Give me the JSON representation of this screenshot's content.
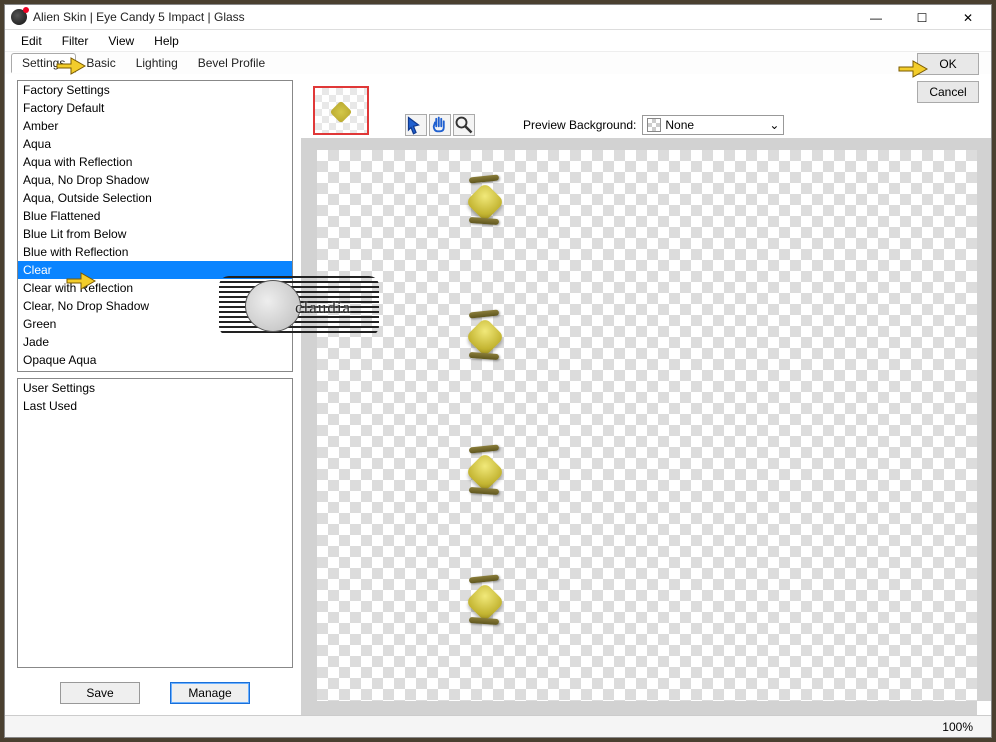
{
  "window": {
    "title": "Alien Skin | Eye Candy 5 Impact | Glass",
    "controls": {
      "minimize": "—",
      "maximize": "☐",
      "close": "✕"
    }
  },
  "menubar": [
    "Edit",
    "Filter",
    "View",
    "Help"
  ],
  "tabs": [
    "Settings",
    "Basic",
    "Lighting",
    "Bevel Profile"
  ],
  "active_tab": "Settings",
  "dialog_buttons": {
    "ok": "OK",
    "cancel": "Cancel"
  },
  "factory": {
    "heading": "Factory Settings",
    "items": [
      "Factory Default",
      "Amber",
      "Aqua",
      "Aqua with Reflection",
      "Aqua, No Drop Shadow",
      "Aqua, Outside Selection",
      "Blue Flattened",
      "Blue Lit from Below",
      "Blue with Reflection",
      "Clear",
      "Clear with Reflection",
      "Clear, No Drop Shadow",
      "Green",
      "Jade",
      "Opaque Aqua"
    ],
    "selected_index": 9
  },
  "user": {
    "heading": "User Settings",
    "items": [
      "Last Used"
    ]
  },
  "panel_buttons": {
    "save": "Save",
    "manage": "Manage"
  },
  "preview": {
    "bg_label": "Preview Background:",
    "bg_value": "None"
  },
  "statusbar": {
    "zoom": "100%"
  },
  "watermark": {
    "text": "claudia"
  }
}
